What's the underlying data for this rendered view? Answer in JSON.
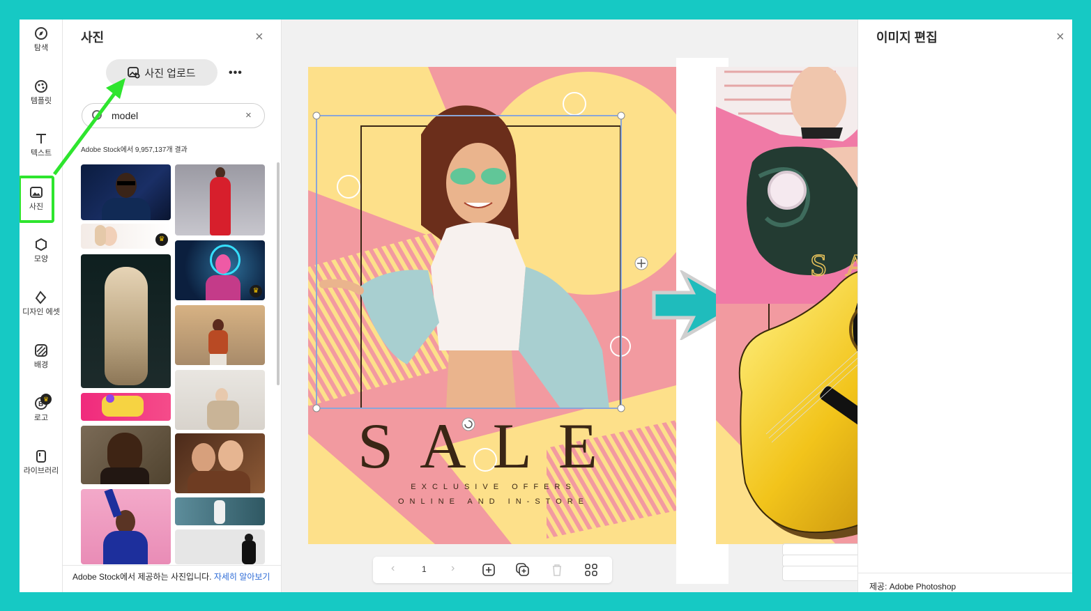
{
  "rail": {
    "items": [
      {
        "label": "탐색",
        "icon": "compass-icon"
      },
      {
        "label": "템플릿",
        "icon": "template-icon"
      },
      {
        "label": "텍스트",
        "icon": "text-icon"
      },
      {
        "label": "사진",
        "icon": "photo-icon"
      },
      {
        "label": "모양",
        "icon": "shape-icon"
      },
      {
        "label": "디자인 에셋",
        "icon": "design-asset-icon"
      },
      {
        "label": "배경",
        "icon": "background-icon"
      },
      {
        "label": "로고",
        "icon": "logo-icon"
      },
      {
        "label": "라이브러리",
        "icon": "library-icon"
      }
    ]
  },
  "panel": {
    "title": "사진",
    "close": "×",
    "upload_label": "사진 업로드",
    "more": "•••",
    "search_value": "model",
    "clear": "×",
    "results_text": "Adobe Stock에서 9,957,137개 결과",
    "footer_text": "Adobe Stock에서 제공하는 사진입니다.",
    "footer_link": "자세히 알아보기"
  },
  "design": {
    "sale": "SALE",
    "line1": "EXCLUSIVE OFFERS",
    "line2": "ONLINE AND IN-STORE"
  },
  "page_bar": {
    "prev": "‹",
    "page": "1",
    "next": "›"
  },
  "right_panel": {
    "title": "이미지 편집",
    "close": "×",
    "footer": "제공: Adobe Photoshop"
  },
  "colors": {
    "border": "#16c9c4",
    "highlight": "#2ee52e",
    "pink": "#f29aa0",
    "yellow": "#fde08a",
    "arrow_teal": "#1fbcbc"
  }
}
